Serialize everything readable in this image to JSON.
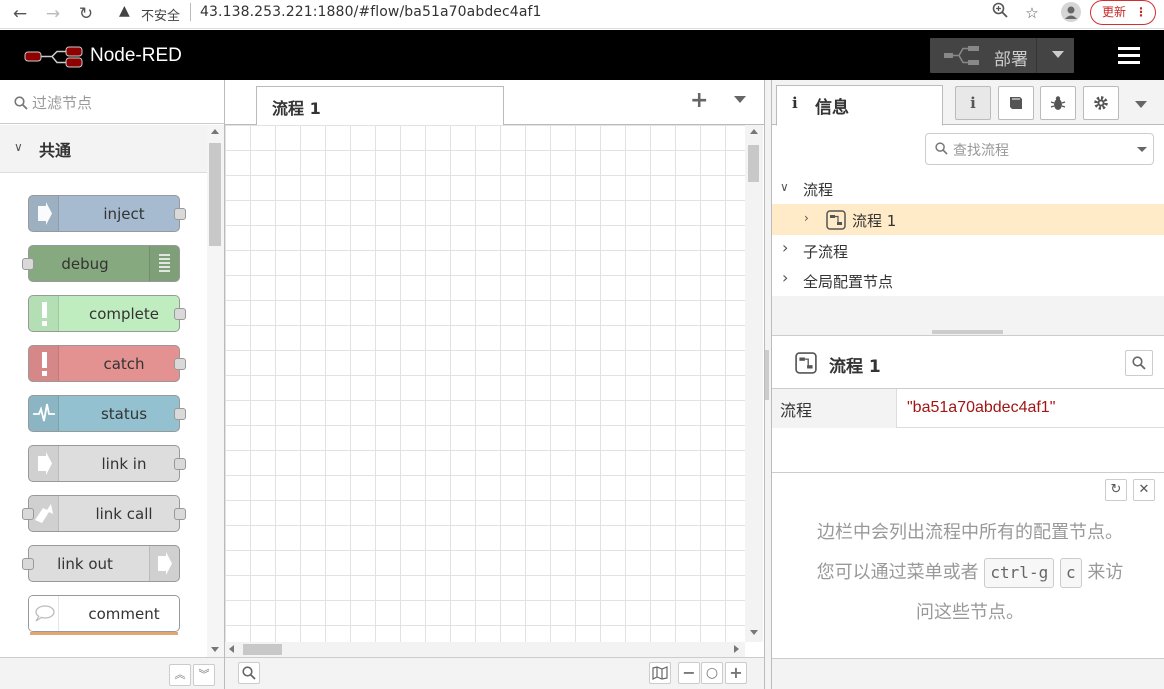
{
  "browser": {
    "insecure_label": "不安全",
    "url": "43.138.253.221:1880/#flow/ba51a70abdec4af1",
    "update_label": "更新"
  },
  "app": {
    "title": "Node-RED",
    "deploy_label": "部署"
  },
  "palette": {
    "search_placeholder": "过滤节点",
    "category": "共通",
    "nodes": [
      {
        "label": "inject",
        "color": "#a6bbcf"
      },
      {
        "label": "debug",
        "color": "#87a980"
      },
      {
        "label": "complete",
        "color": "#c0edc0"
      },
      {
        "label": "catch",
        "color": "#e49191"
      },
      {
        "label": "status",
        "color": "#94c1d0"
      },
      {
        "label": "link in",
        "color": "#dddddd"
      },
      {
        "label": "link call",
        "color": "#dddddd"
      },
      {
        "label": "link out",
        "color": "#dddddd"
      },
      {
        "label": "comment",
        "color": "#ffffff"
      }
    ]
  },
  "workspace": {
    "tab_label": "流程 1"
  },
  "sidebar": {
    "tab_label": "信息",
    "search_placeholder": "查找流程",
    "tree": {
      "flows_label": "流程",
      "flow_item": "流程 1",
      "subflows_label": "子流程",
      "config_label": "全局配置节点"
    },
    "detail": {
      "title": "流程 1",
      "prop_key": "流程",
      "prop_value": "\"ba51a70abdec4af1\""
    },
    "help": {
      "line1": "边栏中会列出流程中所有的配置节点。",
      "line2_pre": "您可以通过菜单或者",
      "kbd1": "ctrl-g",
      "kbd2": "c",
      "line2_post": "来访",
      "line3": "问这些节点。"
    }
  },
  "colors": {
    "header_bg": "#000000",
    "selected_row": "#ffebc7",
    "accent_red": "#8f0000"
  }
}
